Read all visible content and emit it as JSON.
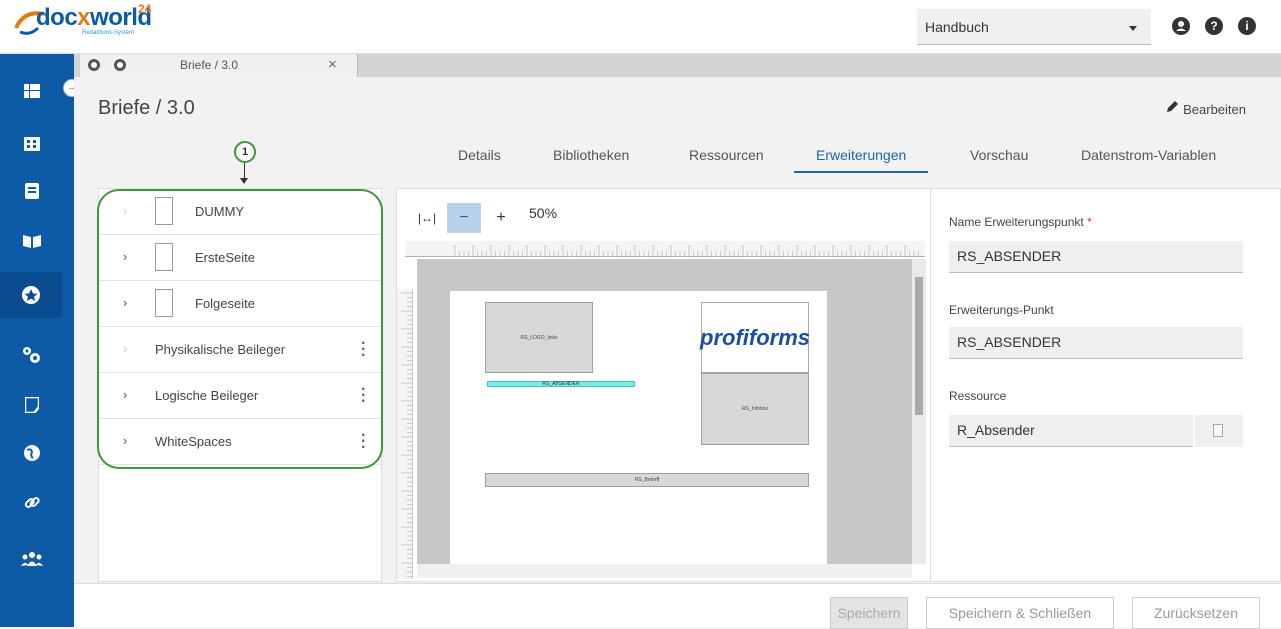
{
  "app": {
    "name": "docxworld",
    "superscript": "24",
    "subtitle": "Redaktions-System"
  },
  "header": {
    "manual_select": "Handbuch",
    "icons": [
      "user-icon",
      "help-icon",
      "info-icon"
    ]
  },
  "sidebar": {
    "items": [
      "dashboard-icon",
      "building-icon",
      "document-icon",
      "book-icon",
      "star-icon",
      "settings-icon",
      "page-icon",
      "globe-icon",
      "link-icon",
      "users-icon"
    ],
    "active_index": 4
  },
  "doc_tab": {
    "title": "Briefe / 3.0",
    "close": "×"
  },
  "page": {
    "title": "Briefe / 3.0",
    "edit_label": "Bearbeiten"
  },
  "tabs": [
    "Details",
    "Bibliotheken",
    "Ressourcen",
    "Erweiterungen",
    "Vorschau",
    "Datenstrom-Variablen"
  ],
  "active_tab": "Erweiterungen",
  "marker": "1",
  "tree": [
    {
      "label": "DUMMY",
      "has_page": true,
      "dim_chevron": true,
      "menu": false
    },
    {
      "label": "ErsteSeite",
      "has_page": true,
      "dim_chevron": false,
      "menu": false
    },
    {
      "label": "Folgeseite",
      "has_page": true,
      "dim_chevron": false,
      "menu": false
    },
    {
      "label": "Physikalische Beileger",
      "has_page": false,
      "dim_chevron": true,
      "menu": true
    },
    {
      "label": "Logische Beileger",
      "has_page": false,
      "dim_chevron": false,
      "menu": true
    },
    {
      "label": "WhiteSpaces",
      "has_page": false,
      "dim_chevron": false,
      "menu": true
    }
  ],
  "preview": {
    "fit_symbol": "|↔|",
    "minus": "−",
    "plus": "+",
    "zoom": "50%",
    "brand": "profiforms",
    "boxes": {
      "logo": "RS_LOGO_links",
      "absender": "RS_ABSENDER",
      "infobox": "RS_Infobox",
      "betreff": "RS_Betreff"
    }
  },
  "props": {
    "name_label": "Name Erweiterungspunkt",
    "required_mark": "*",
    "name_value": "RS_ABSENDER",
    "point_label": "Erweiterungs-Punkt",
    "point_value": "RS_ABSENDER",
    "resource_label": "Ressource",
    "resource_value": "R_Absender"
  },
  "footer": {
    "save": "Speichern",
    "save_close": "Speichern & Schließen",
    "reset": "Zurücksetzen"
  }
}
